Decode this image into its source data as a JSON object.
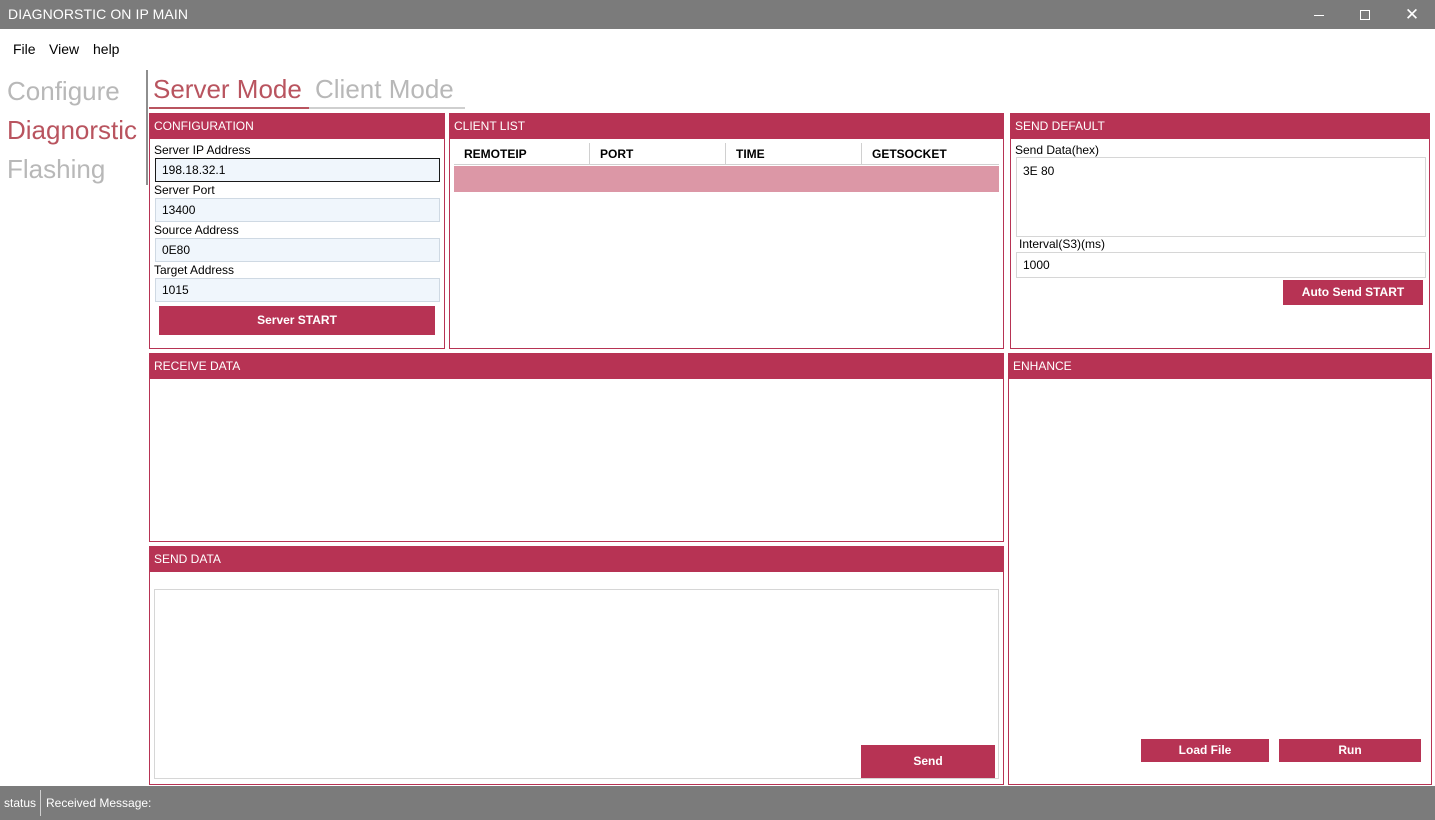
{
  "window": {
    "title": "DIAGNORSTIC ON IP MAIN"
  },
  "menu": {
    "file": "File",
    "view": "View",
    "help": "help"
  },
  "leftnav": {
    "configure": "Configure",
    "diagnorstic": "Diagnorstic",
    "flashing": "Flashing"
  },
  "tabs": {
    "server": "Server Mode",
    "client": "Client Mode"
  },
  "configuration": {
    "title": "CONFIGURATION",
    "server_ip_label": "Server IP Address",
    "server_ip": "198.18.32.1",
    "server_port_label": "Server Port",
    "server_port": "13400",
    "source_label": "Source Address",
    "source": "0E80",
    "target_label": "Target Address",
    "target": "1015",
    "start_button": "Server START"
  },
  "client_list": {
    "title": "CLIENT LIST",
    "columns": [
      "REMOTEIP",
      "PORT",
      "TIME",
      "GETSOCKET"
    ]
  },
  "send_default": {
    "title": "SEND DEFAULT",
    "data_label": "Send Data(hex)",
    "data": "3E 80",
    "interval_label": "Interval(S3)(ms)",
    "interval": "1000",
    "auto_button": "Auto Send START"
  },
  "receive": {
    "title": "RECEIVE DATA"
  },
  "send_data": {
    "title": "SEND DATA",
    "send_button": "Send"
  },
  "enhance": {
    "title": "ENHANCE",
    "load_button": "Load File",
    "run_button": "Run"
  },
  "status": {
    "label": "status",
    "message": "Received Message:"
  },
  "colors": {
    "accent": "#b73354",
    "selected_row": "#dc97a6",
    "titlebar": "#7b7b7b",
    "active_nav": "#b9545f"
  }
}
